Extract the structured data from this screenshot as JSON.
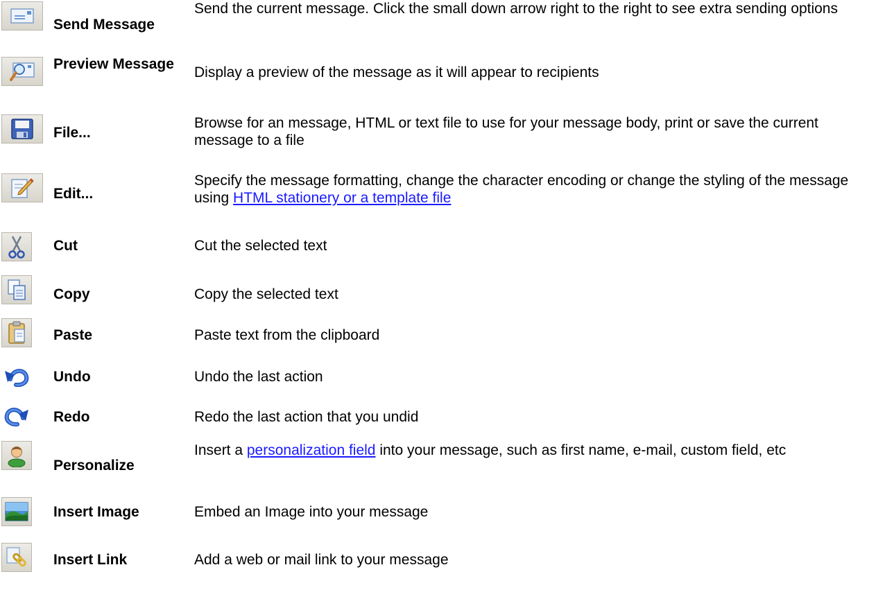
{
  "items": [
    {
      "name": "Send Message",
      "description": "Send the current message.  Click the small down arrow right to the right to see extra sending options",
      "icon": "send-message-icon"
    },
    {
      "name": "Preview Message",
      "description": "Display a preview of the message as it will appear to recipients",
      "icon": "preview-message-icon"
    },
    {
      "name": "File...",
      "description": "Browse for an message, HTML or text file to use for your message body, print or save the current message to a file",
      "icon": "floppy-disk-icon"
    },
    {
      "name": "Edit...",
      "description_before": "Specify the message formatting, change the character encoding or change the styling of the message using ",
      "link": "HTML stationery or a template file",
      "description_after": "",
      "icon": "pencil-icon"
    },
    {
      "name": "Cut",
      "description": "Cut the selected text",
      "icon": "scissors-icon"
    },
    {
      "name": "Copy",
      "description": "Copy the selected text",
      "icon": "copy-icon"
    },
    {
      "name": "Paste",
      "description": "Paste text from the clipboard",
      "icon": "clipboard-icon"
    },
    {
      "name": "Undo",
      "description": "Undo the last action",
      "icon": "undo-icon"
    },
    {
      "name": "Redo",
      "description": "Redo the last action that you undid",
      "icon": "redo-icon"
    },
    {
      "name": "Personalize",
      "description_before": "Insert a ",
      "link": "personalization field",
      "description_after": " into your message, such as first name, e-mail, custom field, etc",
      "icon": "person-icon"
    },
    {
      "name": "Insert Image",
      "description": "Embed an Image into your message",
      "icon": "image-icon"
    },
    {
      "name": "Insert Link",
      "description": "Add a web or mail link to your message",
      "icon": "chain-link-icon"
    }
  ]
}
